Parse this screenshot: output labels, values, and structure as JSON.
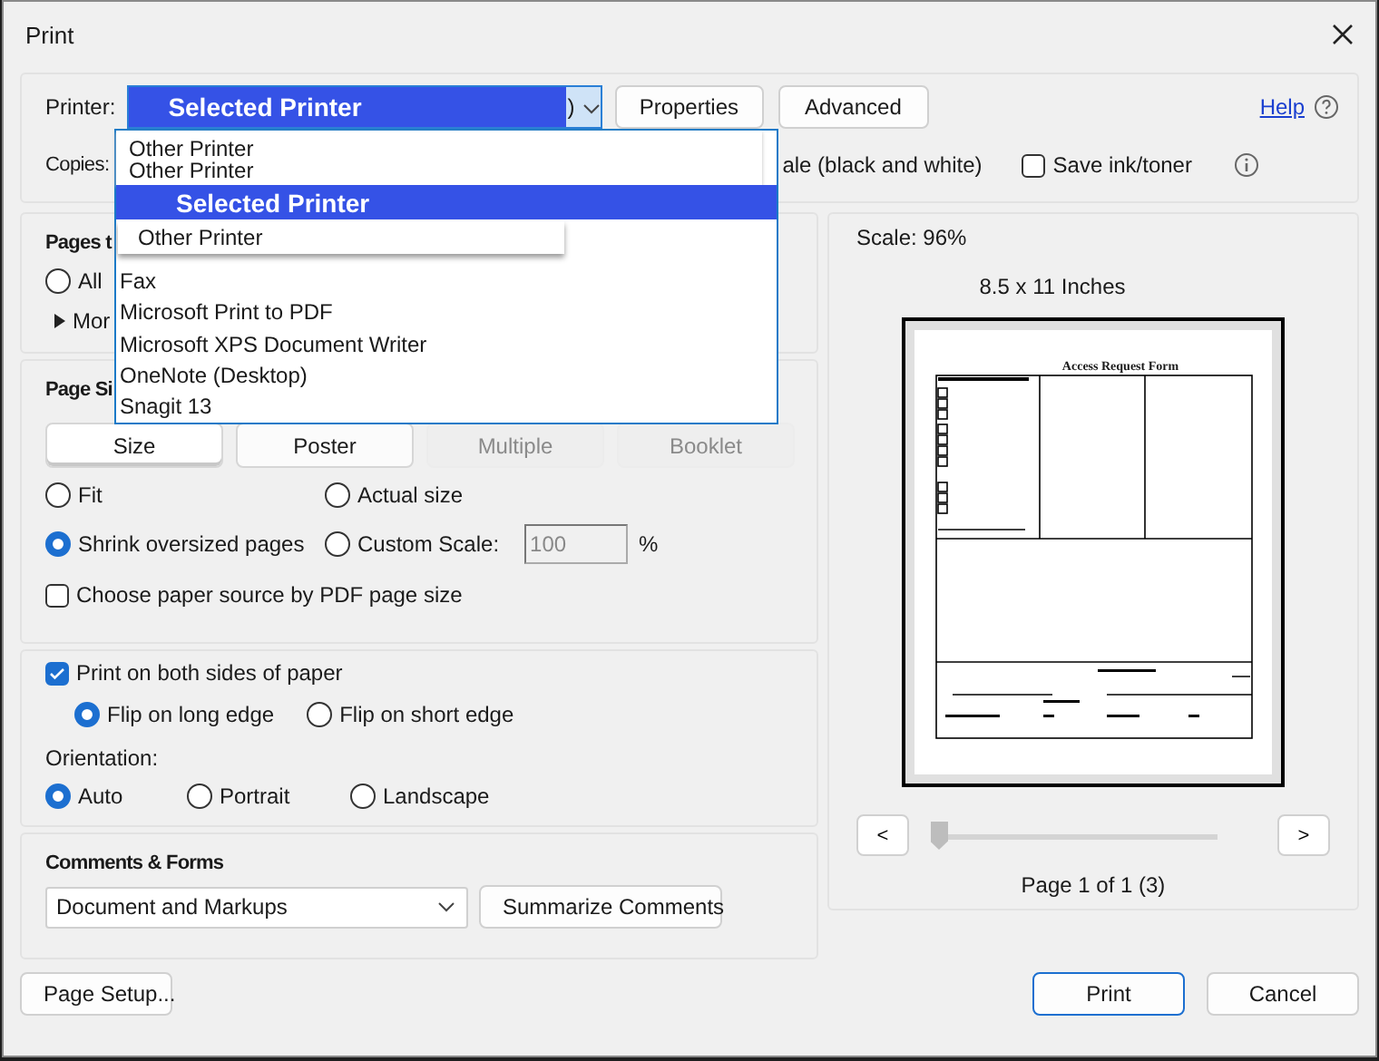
{
  "window": {
    "title": "Print"
  },
  "printer": {
    "label": "Printer:",
    "value": "Selected Printer",
    "value_tail": ")",
    "expanded": true
  },
  "top_buttons": [
    "Properties",
    "Advanced"
  ],
  "help": "Help",
  "copies": {
    "label": "Copies:"
  },
  "grayscale_fragment": "ale (black and white)",
  "save_ink": {
    "label": "Save ink/toner",
    "checked": false
  },
  "printer_list": [
    {
      "label": "Other Printer",
      "kind": "stacked",
      "selected": false
    },
    {
      "label": "Other Printer",
      "kind": "stacked",
      "selected": false
    },
    {
      "label": "Selected Printer",
      "kind": "plain",
      "selected": true
    },
    {
      "label": "Other Printer",
      "kind": "boxed",
      "selected": false
    },
    {
      "label": "Fax",
      "kind": "plain",
      "selected": false
    },
    {
      "label": "Microsoft Print to PDF",
      "kind": "plain",
      "selected": false
    },
    {
      "label": "Microsoft XPS Document Writer",
      "kind": "plain",
      "selected": false
    },
    {
      "label": "OneNote (Desktop)",
      "kind": "plain",
      "selected": false
    },
    {
      "label": "Snagit 13",
      "kind": "plain",
      "selected": false
    }
  ],
  "pages_to_print": {
    "heading": "Pages t",
    "options": [
      {
        "label": "All",
        "selected": false
      }
    ],
    "more": "Mor"
  },
  "page_sizing": {
    "heading": "Page Si",
    "tabs": [
      {
        "label": "Size",
        "selected": true,
        "disabled": false
      },
      {
        "label": "Poster",
        "selected": false,
        "disabled": false
      },
      {
        "label": "Multiple",
        "selected": false,
        "disabled": true
      },
      {
        "label": "Booklet",
        "selected": false,
        "disabled": true
      }
    ],
    "options": [
      {
        "label": "Fit",
        "selected": false
      },
      {
        "label": "Actual size",
        "selected": false
      },
      {
        "label": "Shrink oversized pages",
        "selected": true
      },
      {
        "label": "Custom Scale:",
        "selected": false
      }
    ],
    "custom_scale": {
      "value": "100",
      "unit": "%",
      "disabled": true
    },
    "paper_source": {
      "label": "Choose paper source by PDF page size",
      "checked": false
    }
  },
  "duplex": {
    "label": "Print on both sides of paper",
    "checked": true,
    "options": [
      {
        "label": "Flip on long edge",
        "selected": true
      },
      {
        "label": "Flip on short edge",
        "selected": false
      }
    ]
  },
  "orientation": {
    "label": "Orientation:",
    "options": [
      {
        "label": "Auto",
        "selected": true
      },
      {
        "label": "Portrait",
        "selected": false
      },
      {
        "label": "Landscape",
        "selected": false
      }
    ]
  },
  "comments": {
    "heading": "Comments & Forms",
    "value": "Document and Markups",
    "button": "Summarize Comments"
  },
  "preview": {
    "scale": "Scale:  96%",
    "size": "8.5 x 11 Inches",
    "document_title": "Access Request Form",
    "prev": "<",
    "next": ">",
    "slider": {
      "level": 0
    },
    "page_label": "Page 1 of 1 (3)"
  },
  "footer": {
    "page_setup": "Page Setup...",
    "print": "Print",
    "cancel": "Cancel"
  }
}
